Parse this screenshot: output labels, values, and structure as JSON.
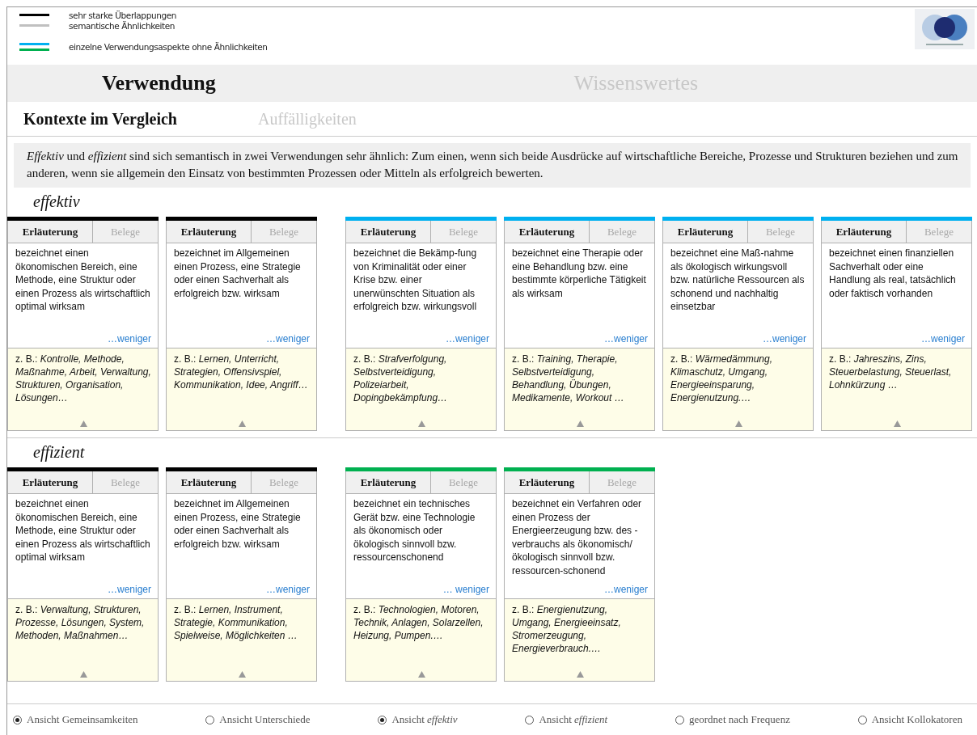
{
  "legend": [
    {
      "label": "sehr starke Überlappungen",
      "lines": [
        {
          "color": "#000000"
        }
      ]
    },
    {
      "label": "semantische Ähnlichkeiten",
      "lines": [
        {
          "color": "#c0c0c0"
        }
      ]
    },
    {
      "label": "einzelne Verwendungsaspekte ohne Ähnlichkeiten",
      "lines": [
        {
          "color": "#00b0f0"
        },
        {
          "color": "#00b050"
        }
      ]
    }
  ],
  "main_tabs": [
    {
      "label": "Verwendung",
      "selected": true
    },
    {
      "label": "Wissenswertes",
      "selected": false
    }
  ],
  "sub_tabs": [
    {
      "label": "Kontexte im Vergleich",
      "selected": true
    },
    {
      "label": "Auffälligkeiten",
      "selected": false
    }
  ],
  "intro": "*Effektiv* und *effizient* sind sich semantisch in zwei Verwendungen sehr ähnlich: Zum einen, wenn sich beide Ausdrücke auf wirtschaftliche Bereiche, Prozesse und Strukturen beziehen und zum anderen, wenn sie allgemein den Einsatz von bestimmten Prozessen oder Mitteln als erfolgreich bewerten.",
  "sections": [
    {
      "title": "effektiv",
      "groups": [
        {
          "cards": [
            {
              "color": "#000000",
              "tabs": [
                {
                  "label": "Erläuterung",
                  "selected": true
                },
                {
                  "label": "Belege",
                  "selected": false
                }
              ],
              "definition": "bezeichnet einen ökonomischen Bereich, eine Methode, eine Struktur oder einen Prozess als wirtschaftlich optimal wirksam",
              "more": "…weniger",
              "examples": "z. B.: *Kontrolle, Methode, Maßnahme, Arbeit, Verwaltung, Strukturen, Organisation, Lösungen…*"
            },
            {
              "color": "#000000",
              "tabs": [
                {
                  "label": "Erläuterung",
                  "selected": true
                },
                {
                  "label": "Belege",
                  "selected": false
                }
              ],
              "definition": "bezeichnet im Allgemeinen einen Prozess, eine Strategie oder einen Sachverhalt als erfolgreich bzw. wirksam",
              "more": "…weniger",
              "examples": "z. B.: *Lernen, Unterricht, Strategien, Offensivspiel, Kommunikation, Idee, Angriff…*"
            }
          ]
        },
        {
          "cards": [
            {
              "color": "#00b0f0",
              "tabs": [
                {
                  "label": "Erläuterung",
                  "selected": true
                },
                {
                  "label": "Belege",
                  "selected": false
                }
              ],
              "definition": "bezeichnet die Bekämp-fung von Kriminalität oder einer Krise bzw. einer unerwünschten Situation als erfolgreich bzw. wirkungsvoll",
              "more": "…weniger",
              "examples": "z. B.: *Strafverfolgung, Selbstverteidigung, Polizeiarbeit, Dopingbekämpfung…*"
            },
            {
              "color": "#00b0f0",
              "tabs": [
                {
                  "label": "Erläuterung",
                  "selected": true
                },
                {
                  "label": "Belege",
                  "selected": false
                }
              ],
              "definition": "bezeichnet eine Therapie oder eine Behandlung bzw. eine bestimmte körperliche Tätigkeit als wirksam",
              "more": "…weniger",
              "examples": "z. B.: *Training, Therapie, Selbstverteidigung, Behandlung, Übungen, Medikamente, Workout …*"
            },
            {
              "color": "#00b0f0",
              "tabs": [
                {
                  "label": "Erläuterung",
                  "selected": true
                },
                {
                  "label": "Belege",
                  "selected": false
                }
              ],
              "definition": "bezeichnet eine Maß-nahme als ökologisch wirkungsvoll bzw. natürliche Ressourcen als schonend und nachhaltig einsetzbar",
              "more": "…weniger",
              "examples": "z. B.: *Wärmedämmung, Klimaschutz, Umgang, Energieeinsparung, Energienutzung.…*"
            },
            {
              "color": "#00b0f0",
              "tabs": [
                {
                  "label": "Erläuterung",
                  "selected": true
                },
                {
                  "label": "Belege",
                  "selected": false
                }
              ],
              "definition": "bezeichnet einen finanziellen Sachverhalt oder eine Handlung als real, tatsächlich oder faktisch vorhanden",
              "more": "…weniger",
              "examples": "z. B.: *Jahreszins, Zins, Steuerbelastung, Steuerlast, Lohnkürzung …*"
            }
          ]
        }
      ]
    },
    {
      "title": "effizient",
      "groups": [
        {
          "cards": [
            {
              "color": "#000000",
              "tabs": [
                {
                  "label": "Erläuterung",
                  "selected": true
                },
                {
                  "label": "Belege",
                  "selected": false
                }
              ],
              "definition": "bezeichnet einen ökonomischen Bereich, eine Methode, eine Struktur oder einen Prozess als wirtschaftlich optimal wirksam",
              "more": "…weniger",
              "examples": "z. B.: *Verwaltung, Strukturen, Prozesse, Lösungen, System, Methoden, Maßnahmen…*"
            },
            {
              "color": "#000000",
              "tabs": [
                {
                  "label": "Erläuterung",
                  "selected": true
                },
                {
                  "label": "Belege",
                  "selected": false
                }
              ],
              "definition": "bezeichnet im Allgemeinen einen Prozess, eine Strategie oder einen Sachverhalt als erfolgreich bzw. wirksam",
              "more": "…weniger",
              "examples": "z. B.: *Lernen, Instrument, Strategie, Kommunikation, Spielweise, Möglichkeiten …*"
            }
          ]
        },
        {
          "cards": [
            {
              "color": "#00b050",
              "tabs": [
                {
                  "label": "Erläuterung",
                  "selected": true
                },
                {
                  "label": "Belege",
                  "selected": false
                }
              ],
              "definition": "bezeichnet ein technisches Gerät bzw. eine Technologie als ökonomisch oder ökologisch sinnvoll bzw. ressourcenschonend",
              "more": "… weniger",
              "examples": "z. B.: *Technologien, Motoren, Technik, Anlagen, Solarzellen, Heizung, Pumpen.…*"
            },
            {
              "color": "#00b050",
              "tabs": [
                {
                  "label": "Erläuterung",
                  "selected": true
                },
                {
                  "label": "Belege",
                  "selected": false
                }
              ],
              "definition": "bezeichnet ein Verfahren oder einen Prozess der Energieerzeugung bzw. des -verbrauchs als ökonomisch/ökologisch sinnvoll bzw. ressourcen-schonend",
              "more": "…weniger",
              "examples": "z. B.: *Energienutzung, Umgang, Energieeinsatz, Stromerzeugung, Energieverbrauch.…*"
            }
          ]
        }
      ]
    }
  ],
  "view_options": [
    {
      "label": "Ansicht Gemeinsamkeiten",
      "selected": true
    },
    {
      "label": "Ansicht Unterschiede",
      "selected": false
    },
    {
      "label": "Ansicht *effektiv*",
      "selected": true
    },
    {
      "label": "Ansicht *effizient*",
      "selected": false
    },
    {
      "label": "geordnet nach  Frequenz",
      "selected": false
    },
    {
      "label": "Ansicht Kollokatoren",
      "selected": false
    }
  ]
}
